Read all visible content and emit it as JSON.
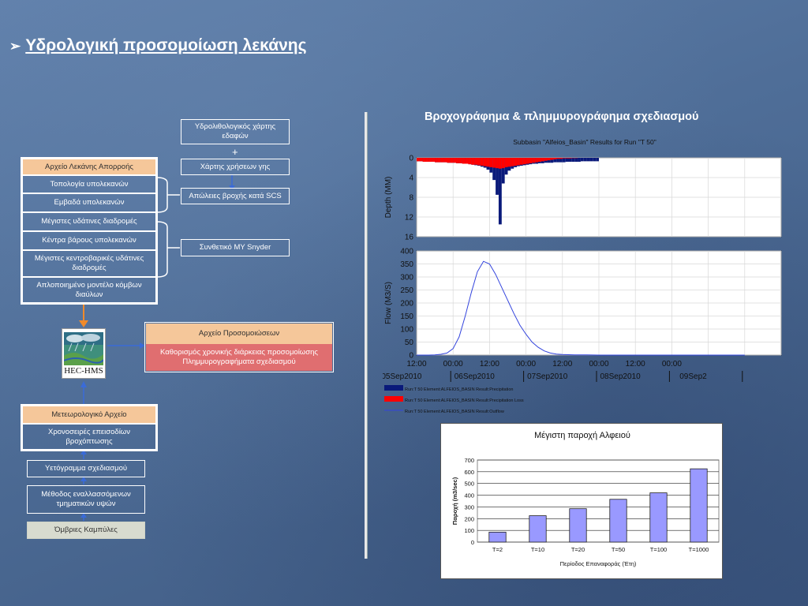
{
  "title": "Υδρολογική προσομοίωση λεκάνης",
  "title_bullet": "➢",
  "left": {
    "basin_header": "Αρχείο Λεκάνης Απορροής",
    "basin_items": [
      "Τοπολογία υπολεκανών",
      "Εμβαδά υπολεκανών",
      "Μέγιστες υδάτινες διαδρομές",
      "Κέντρα βάρους υπολεκανών",
      "Μέγιστες κεντροβαρικές υδάτινες διαδρομές",
      "Απλοποιημένο μοντέλο κόμβων διαύλων"
    ],
    "geo_map": "Υδρολιθολογικός χάρτης εδαφών",
    "plus": "+",
    "landuse_map": "Χάρτης χρήσεων γης",
    "scs_losses": "Απώλειες βροχής κατά SCS",
    "snyder": "Συνθετικό ΜΥ Snyder",
    "hec_label": "HEC-HMS",
    "sim_header": "Αρχείο Προσομοιώσεων",
    "sim_body_1": "Καθορισμός χρονικής διάρκειας προσομοίωσης",
    "sim_body_2": "Πλημμυρογραφήματα σχεδιασμού",
    "met_header": "Μετεωρολογικό Αρχείο",
    "met_item": "Χρονοσειρές επεισοδίων βροχόπτωσης",
    "design_hyeto": "Υετόγραμμα σχεδιασμού",
    "alt_blocks": "Μέθοδος εναλλασσόμενων τμηματικών υψών",
    "idf": "Όμβριες Καμπύλες"
  },
  "right_heading": "Βροχογράφημα & πλημμυρογράφημα σχεδιασμού",
  "chart_data": [
    {
      "type": "line",
      "title": "Subbasin \"Alfeios_Basin\" Results for Run \"T 50\"",
      "panels": [
        {
          "ylabel": "Depth (MM)",
          "ylim": [
            0,
            16
          ],
          "y_inverted": true,
          "yticks": [
            0,
            4,
            8,
            12,
            16
          ],
          "series": [
            {
              "name": "Run:T 50 Element:ALFEIOS_BASIN Result:Precipitation",
              "color": "#0a1a7a",
              "style": "bar",
              "x": [
                0,
                1,
                2,
                3,
                4,
                5,
                6,
                7,
                8,
                9,
                10,
                11,
                12,
                13,
                14,
                15,
                16,
                17,
                18,
                19,
                20,
                21,
                22,
                23,
                24,
                25,
                26,
                27,
                28,
                29,
                30,
                31,
                32,
                33,
                34,
                35,
                36,
                37,
                38,
                39,
                40,
                41,
                42,
                43,
                44,
                45,
                46,
                47,
                48,
                49,
                50,
                51,
                52,
                53,
                54,
                55,
                56,
                57,
                58,
                59
              ],
              "values": [
                0.7,
                0.7,
                0.8,
                0.8,
                0.8,
                0.8,
                0.9,
                0.9,
                0.9,
                0.9,
                1.0,
                1.0,
                1.0,
                1.1,
                1.1,
                1.2,
                1.2,
                1.3,
                1.4,
                1.5,
                1.6,
                1.8,
                2.0,
                2.4,
                3.0,
                4.5,
                7.5,
                13.5,
                5.2,
                3.4,
                2.6,
                2.2,
                1.9,
                1.7,
                1.6,
                1.5,
                1.4,
                1.3,
                1.2,
                1.2,
                1.1,
                1.1,
                1.0,
                1.0,
                1.0,
                0.9,
                0.9,
                0.9,
                0.9,
                0.8,
                0.8,
                0.8,
                0.8,
                0.8,
                0.7,
                0.7,
                0.7,
                0.7,
                0.7,
                0.7
              ]
            },
            {
              "name": "Run:T 50 Element:ALFEIOS_BASIN Result:Precipitation Loss",
              "color": "#ff0000",
              "style": "bar",
              "x": [
                0,
                1,
                2,
                3,
                4,
                5,
                6,
                7,
                8,
                9,
                10,
                11,
                12,
                13,
                14,
                15,
                16,
                17,
                18,
                19,
                20,
                21,
                22,
                23,
                24,
                25,
                26,
                27,
                28,
                29,
                30,
                31,
                32,
                33,
                34,
                35,
                36,
                37,
                38,
                39,
                40,
                41,
                42,
                43,
                44,
                45,
                46,
                47,
                48,
                49,
                50,
                51,
                52,
                53,
                54,
                55,
                56,
                57,
                58,
                59
              ],
              "values": [
                0.7,
                0.7,
                0.8,
                0.8,
                0.8,
                0.8,
                0.9,
                0.9,
                0.9,
                0.9,
                1.0,
                1.0,
                1.0,
                1.1,
                1.1,
                1.2,
                1.2,
                1.3,
                1.4,
                1.4,
                1.5,
                1.6,
                1.7,
                1.8,
                1.9,
                2.0,
                2.1,
                2.2,
                2.1,
                1.9,
                1.8,
                1.7,
                1.6,
                1.5,
                1.4,
                1.3,
                1.2,
                1.1,
                1.0,
                0.9,
                0.8,
                0.7,
                0.6,
                0.5,
                0.4,
                0.3,
                0.2,
                0.2,
                0.1,
                0.1,
                0.1,
                0.05,
                0.05,
                0,
                0,
                0,
                0,
                0,
                0,
                0
              ]
            }
          ]
        },
        {
          "ylabel": "Flow (M3/S)",
          "ylim": [
            0,
            400
          ],
          "yticks": [
            0,
            50,
            100,
            150,
            200,
            250,
            300,
            350,
            400
          ],
          "series": [
            {
              "name": "Run:T 50 Element:ALFEIOS_BASIN Result:Outflow",
              "color": "#3344dd",
              "style": "line",
              "x": [
                0,
                2,
                4,
                6,
                8,
                10,
                12,
                14,
                16,
                18,
                20,
                22,
                24,
                26,
                28,
                30,
                32,
                34,
                36,
                38,
                40,
                42,
                44,
                46,
                48,
                52,
                56,
                60,
                64,
                72,
                84,
                96,
                108
              ],
              "values": [
                0,
                0,
                0,
                1,
                3,
                8,
                25,
                70,
                150,
                240,
                320,
                360,
                350,
                310,
                260,
                210,
                160,
                115,
                80,
                50,
                30,
                16,
                8,
                4,
                2,
                1,
                0.5,
                0,
                0,
                0,
                0,
                0,
                0
              ]
            }
          ]
        }
      ],
      "x_unit": "hours",
      "xlim": [
        0,
        120
      ],
      "xticks": [
        0,
        12,
        24,
        36,
        48,
        60,
        72,
        84,
        96,
        108,
        120
      ],
      "xtick_labels": [
        "12:00",
        "00:00",
        "12:00",
        "00:00",
        "12:00",
        "00:00",
        "12:00",
        "00:00",
        "",
        "",
        ""
      ],
      "xtick_labels_hours": [
        {
          "h": 0,
          "label": "12:00"
        },
        {
          "h": 12,
          "label": "00:00"
        },
        {
          "h": 24,
          "label": "12:00"
        },
        {
          "h": 36,
          "label": "00:00"
        },
        {
          "h": 48,
          "label": "12:00"
        },
        {
          "h": 60,
          "label": "00:00"
        },
        {
          "h": 72,
          "label": "12:00"
        },
        {
          "h": 84,
          "label": "00:00"
        }
      ],
      "xdate_labels": [
        {
          "h": -6,
          "label": "05Sep2010"
        },
        {
          "h": 18,
          "label": "06Sep2010"
        },
        {
          "h": 42,
          "label": "07Sep2010"
        },
        {
          "h": 66,
          "label": "08Sep2010"
        },
        {
          "h": 90,
          "label": "09Sep2"
        }
      ],
      "legend_placement": "bottom",
      "grid": true
    },
    {
      "type": "bar",
      "title": "Μέγιστη παροχή Αλφειού",
      "categories": [
        "T=2",
        "T=10",
        "T=20",
        "T=50",
        "T=100",
        "T=1000"
      ],
      "values": [
        85,
        225,
        285,
        365,
        420,
        625
      ],
      "xlabel": "Περίοδος Επαναφοράς (Έτη)",
      "ylabel": "Παροχή (m3/sec)",
      "ylim": [
        0,
        700
      ],
      "yticks": [
        0,
        100,
        200,
        300,
        400,
        500,
        600,
        700
      ],
      "bar_color": "#9999ff",
      "grid": true
    }
  ]
}
